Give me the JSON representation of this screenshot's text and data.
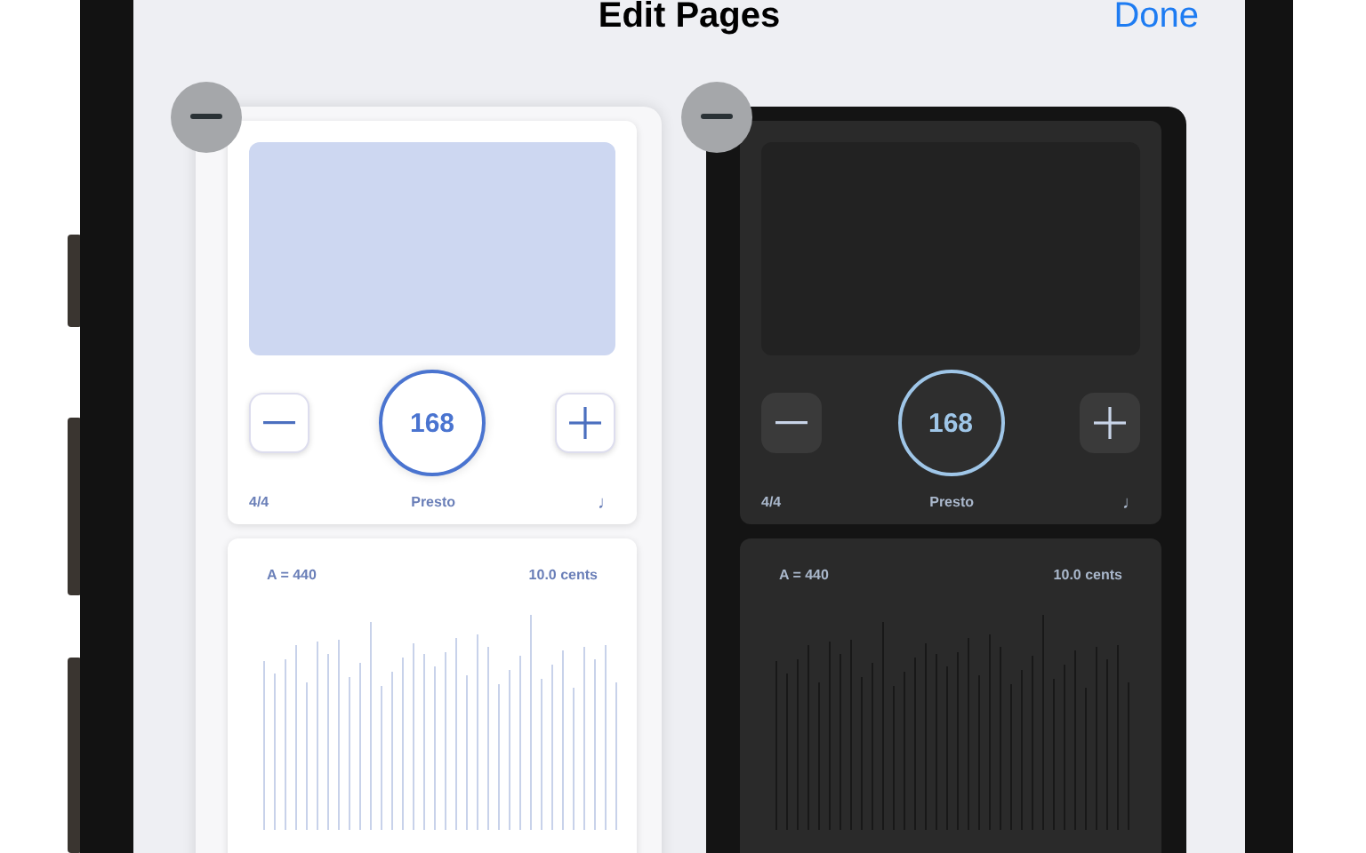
{
  "title": "Edit Pages",
  "done": "Done",
  "pages": [
    {
      "kind": "light",
      "metronome": {
        "time_signature": "4/4",
        "tempo": "168",
        "marking": "Presto",
        "note": "♩"
      },
      "tuner": {
        "reference": "A = 440",
        "cents": "10.0 cents"
      }
    },
    {
      "kind": "dark",
      "metronome": {
        "time_signature": "4/4",
        "tempo": "168",
        "marking": "Presto",
        "note": "♩"
      },
      "tuner": {
        "reference": "A = 440",
        "cents": "10.0 cents"
      }
    }
  ]
}
